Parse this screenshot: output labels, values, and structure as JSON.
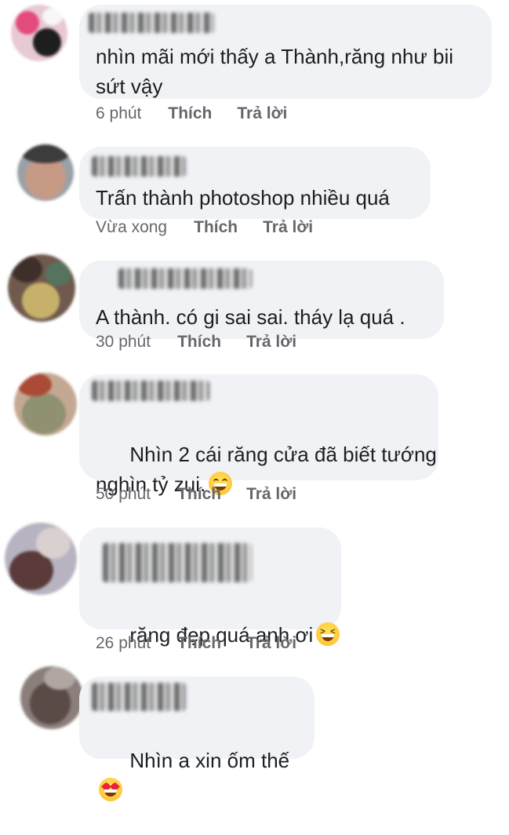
{
  "comments": [
    {
      "text": "nhìn mãi mới thấy a Thành,răng như bii\nsứt vậy",
      "time": "6 phút",
      "like": "Thích",
      "reply": "Trả lời",
      "emoji": ""
    },
    {
      "text": "Trấn thành photoshop nhiều quá",
      "time": "Vừa xong",
      "like": "Thích",
      "reply": "Trả lời",
      "emoji": ""
    },
    {
      "text": "A thành. có gi sai sai. tháy lạ quá .",
      "time": "30 phút",
      "like": "Thích",
      "reply": "Trả lời",
      "emoji": ""
    },
    {
      "text": "Nhìn 2 cái răng cửa đã biết tướng\nnghìn tỷ zui.",
      "time": "50 phút",
      "like": "Thích",
      "reply": "Trả lời",
      "emoji": "grinning-face"
    },
    {
      "text": "răng đẹp quá anh ơi",
      "time": "26 phút",
      "like": "Thích",
      "reply": "Trả lời",
      "emoji": "squinting-face"
    },
    {
      "text": "Nhìn a xin ốm thế",
      "time": "",
      "like": "",
      "reply": "",
      "emoji": "heart-eyes-face"
    }
  ]
}
